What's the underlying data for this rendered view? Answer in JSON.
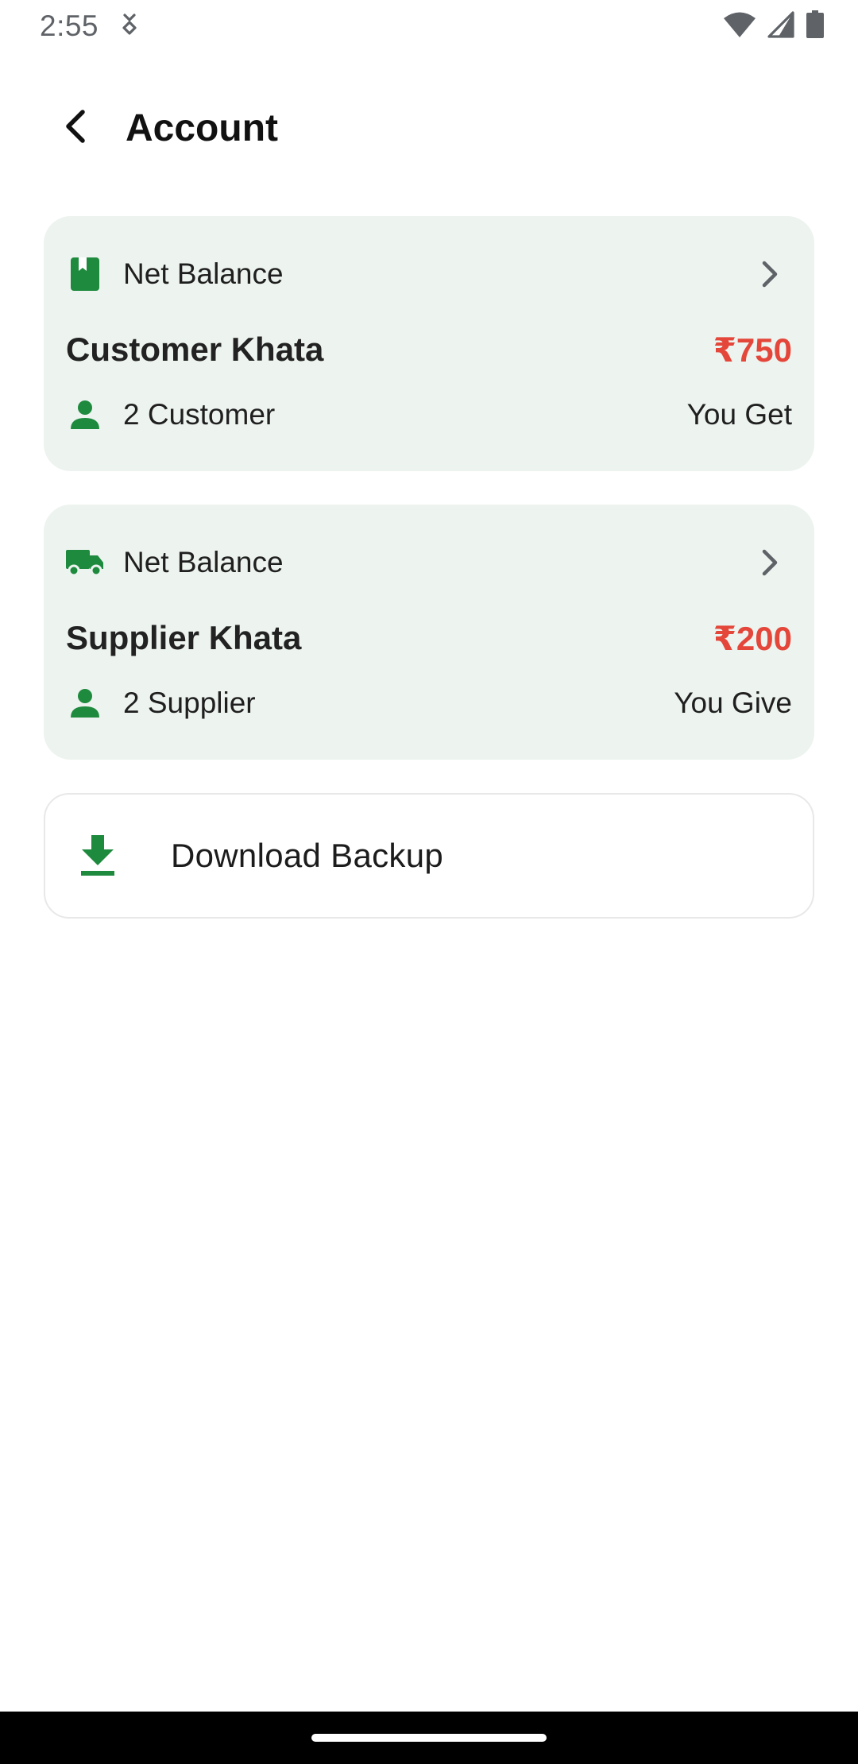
{
  "status_bar": {
    "time": "2:55",
    "icons": [
      "notification-icon",
      "wifi-icon",
      "signal-icon",
      "battery-icon"
    ]
  },
  "app_bar": {
    "title": "Account",
    "back_icon": "back-arrow-icon"
  },
  "customer_card": {
    "icon": "book-icon",
    "header_label": "Net Balance",
    "title": "Customer Khata",
    "amount": "₹750",
    "count_label": "2 Customer",
    "status": "You Get"
  },
  "supplier_card": {
    "icon": "truck-icon",
    "header_label": "Net Balance",
    "title": "Supplier Khata",
    "amount": "₹200",
    "count_label": "2 Supplier",
    "status": "You Give"
  },
  "backup": {
    "label": "Download Backup",
    "icon": "download-icon"
  },
  "colors": {
    "accent_green": "#1e8a3e",
    "amount_red": "#e4463a",
    "card_bg": "#edf3ef"
  }
}
